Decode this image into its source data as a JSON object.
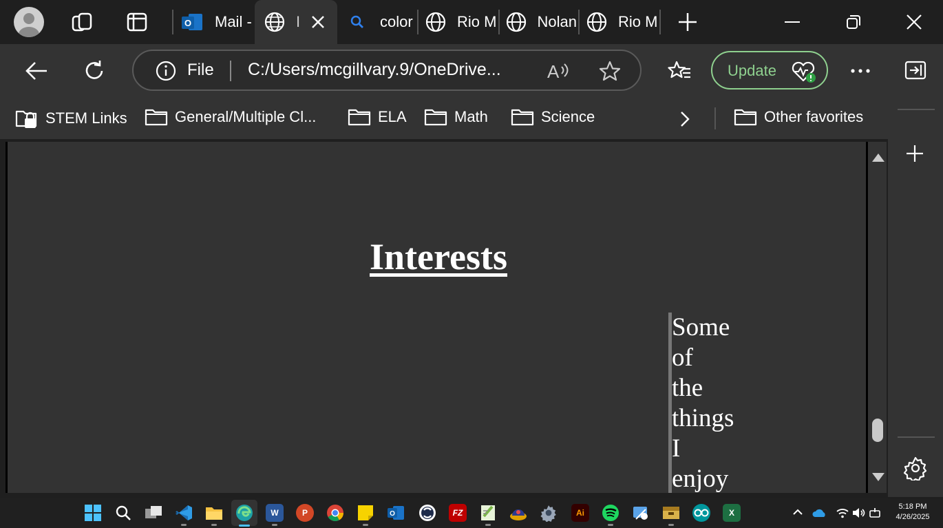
{
  "tabs": [
    {
      "label": "Mail -",
      "icon": "outlook-icon"
    },
    {
      "label": "I",
      "icon": "globe-icon",
      "active": true
    },
    {
      "label": "color",
      "icon": "search-icon"
    },
    {
      "label": "Rio M",
      "icon": "globe-icon"
    },
    {
      "label": "Nolan",
      "icon": "globe-icon"
    },
    {
      "label": "Rio M",
      "icon": "globe-icon"
    }
  ],
  "address": {
    "scheme_label": "File",
    "url": "C:/Users/mcgillvary.9/OneDrive..."
  },
  "toolbar": {
    "update_label": "Update"
  },
  "favorites": [
    {
      "label": "STEM Links",
      "icon": "folder-lock-icon"
    },
    {
      "label": "General/Multiple Cl...",
      "icon": "folder-icon"
    },
    {
      "label": "ELA",
      "icon": "folder-icon"
    },
    {
      "label": "Math",
      "icon": "folder-icon"
    },
    {
      "label": "Science",
      "icon": "folder-icon"
    }
  ],
  "other_favorites": "Other favorites",
  "page": {
    "heading": "Interests",
    "paragraph_words": [
      "Some",
      "of",
      "the",
      "things",
      "I",
      "enjoy"
    ]
  },
  "taskbar": {
    "apps": [
      "start-icon",
      "search-icon",
      "task-view-icon",
      "vscode-icon",
      "file-explorer-icon",
      "edge-icon",
      "word-icon",
      "powerpoint-icon",
      "chrome-icon",
      "sticky-notes-icon",
      "outlook-icon",
      "obs-icon",
      "filezilla-icon",
      "notepadpp-icon",
      "app-icon",
      "settings-icon",
      "illustrator-icon",
      "spotify-icon",
      "snipping-icon",
      "archive-icon",
      "arduino-icon",
      "excel-icon"
    ],
    "time": "5:18 PM",
    "date": "4/26/2025"
  },
  "colors": {
    "accent_update": "#8fd18f",
    "chrome_bg": "#333333",
    "titlebar_bg": "#1f1f1f"
  }
}
